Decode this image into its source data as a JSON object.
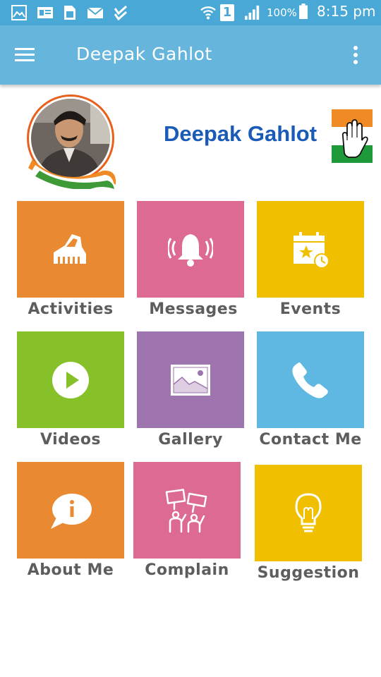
{
  "status_bar": {
    "battery_percent": "100%",
    "time": "8:15 pm",
    "sim_slot": "1"
  },
  "app_bar": {
    "title": "Deepak Gahlot"
  },
  "header": {
    "brand_name": "Deepak Gahlot"
  },
  "tiles": [
    {
      "label": "Activities",
      "color": "#e98a33",
      "icon": "hands-icon"
    },
    {
      "label": "Messages",
      "color": "#dc6a92",
      "icon": "bell-icon"
    },
    {
      "label": "Events",
      "color": "#f0c000",
      "icon": "calendar-icon"
    },
    {
      "label": "Videos",
      "color": "#86c129",
      "icon": "play-icon"
    },
    {
      "label": "Gallery",
      "color": "#9d74ad",
      "icon": "image-icon"
    },
    {
      "label": "Contact Me",
      "color": "#5fb8e2",
      "icon": "phone-icon"
    },
    {
      "label": "About Me",
      "color": "#e98a33",
      "icon": "info-bubble-icon"
    },
    {
      "label": "Complain",
      "color": "#dc6a92",
      "icon": "protest-icon"
    },
    {
      "label": "Suggestion",
      "color": "#f0c000",
      "icon": "lightbulb-icon"
    }
  ]
}
